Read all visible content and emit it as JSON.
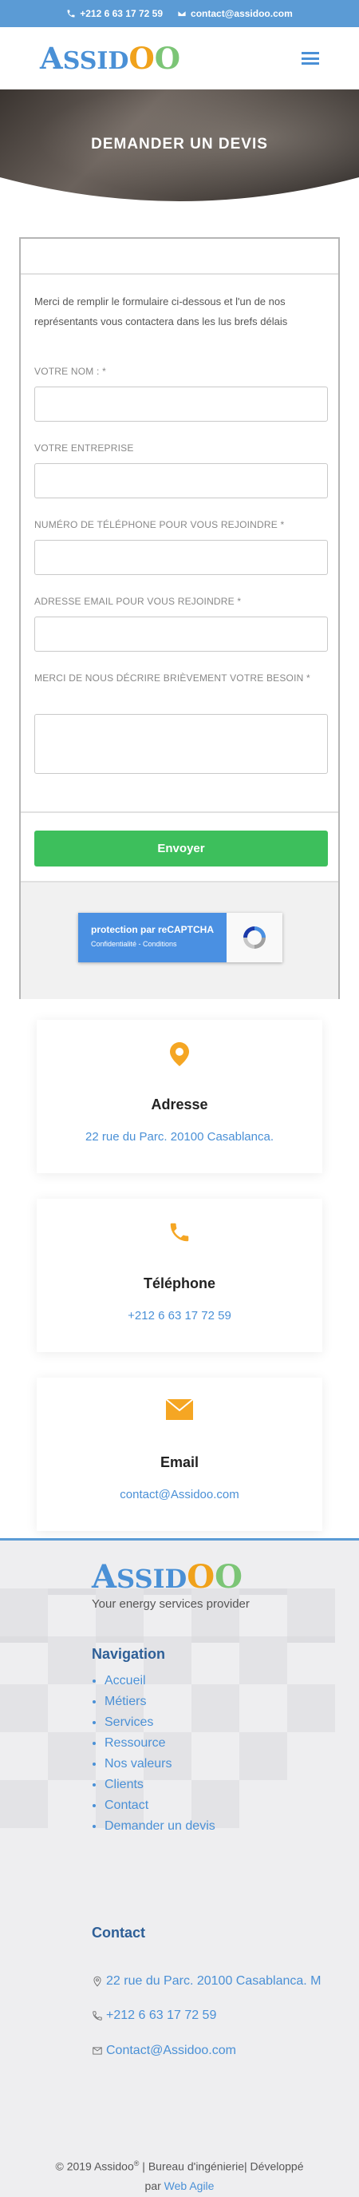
{
  "topbar": {
    "phone": "+212 6 63 17 72 59",
    "email": "contact@assidoo.com"
  },
  "header": {
    "logo": {
      "l1": "A",
      "l2": "SSID",
      "l3": "O",
      "l4": "O"
    },
    "menu_icon": "hamburger-icon"
  },
  "hero": {
    "title": "DEMANDER UN DEVIS"
  },
  "form": {
    "intro": "Merci de remplir le formulaire ci-dessous et l'un de nos représentants vous contactera dans les lus brefs délais",
    "fields": [
      {
        "label": "VOTRE NOM : *"
      },
      {
        "label": "VOTRE ENTREPRISE"
      },
      {
        "label": "NUMÉRO DE TÉLÉPHONE POUR VOUS REJOINDRE *"
      },
      {
        "label": "ADRESSE EMAIL POUR VOUS REJOINDRE *"
      },
      {
        "label": "MERCI DE NOUS DÉCRIRE BRIÈVEMENT VOTRE BESOIN *"
      }
    ],
    "submit_label": "Envoyer",
    "recaptcha": {
      "line1": "protection par reCAPTCHA",
      "line2": "Confidentialité - Conditions"
    }
  },
  "info_cards": [
    {
      "icon": "map-pin-icon",
      "title": "Adresse",
      "value": "22 rue du Parc. 20100 Casablanca."
    },
    {
      "icon": "phone-icon",
      "title": "Téléphone",
      "value": "+212 6 63 17 72 59"
    },
    {
      "icon": "envelope-icon",
      "title": "Email",
      "value": "contact@Assidoo.com"
    }
  ],
  "footer": {
    "tagline": "Your energy services provider",
    "nav_title": "Navigation",
    "nav_items": [
      "Accueil",
      "Métiers",
      "Services",
      "Ressource",
      "Nos valeurs",
      "Clients",
      "Contact",
      "Demander un devis"
    ],
    "contact_title": "Contact",
    "address": "22 rue du Parc. 20100 Casablanca. M",
    "phone": "+212 6 63 17 72 59",
    "email": "Contact@Assidoo.com",
    "copyright_prefix": "© 2019 Assidoo",
    "copyright_sup": "®",
    "copyright_mid": " | Bureau d'ingénierie| Développé",
    "copyright_by": "par ",
    "copyright_link": "Web Agile"
  },
  "colors": {
    "accent": "#5b9bd5",
    "brand_blue": "#4a90d6",
    "brand_orange": "#f0a21b",
    "brand_green": "#7cc576",
    "submit_green": "#3dbf5c",
    "icon_orange": "#f5a623"
  }
}
